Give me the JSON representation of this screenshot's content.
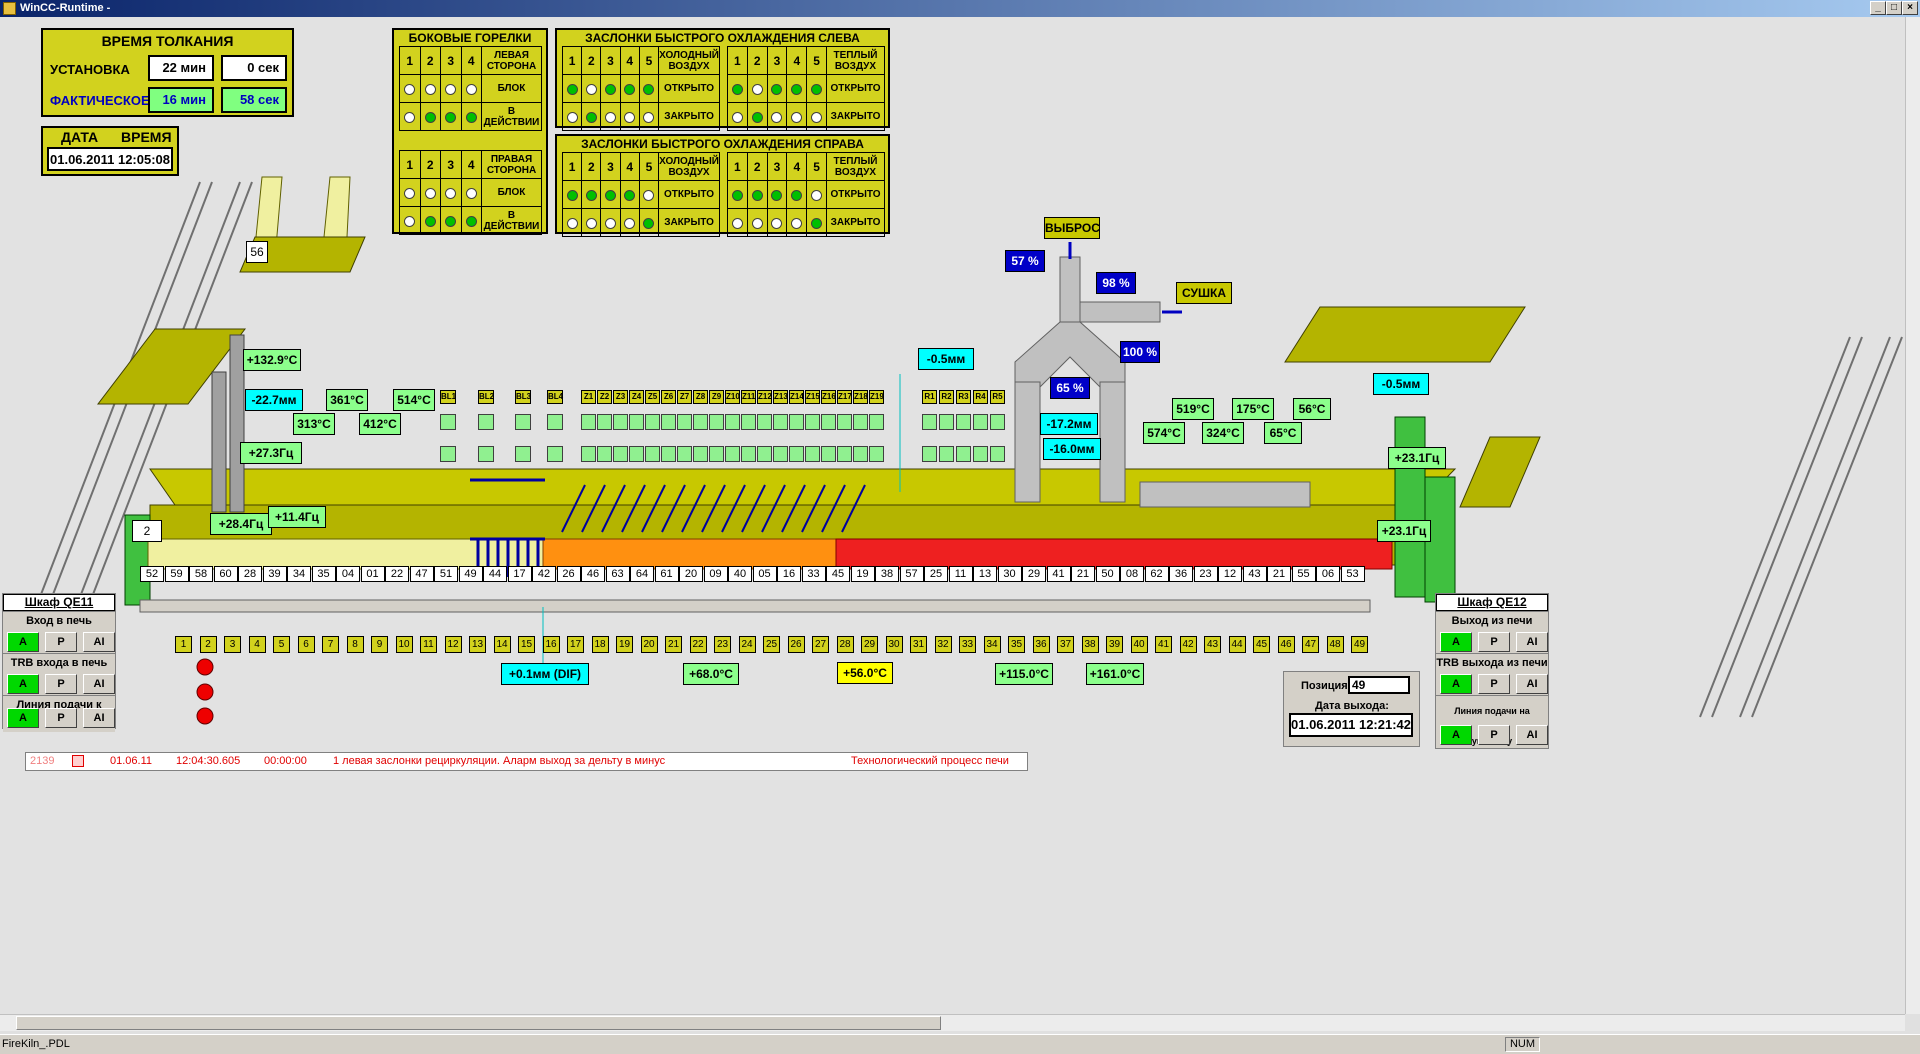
{
  "window": {
    "title": "WinCC-Runtime -"
  },
  "push_time": {
    "title": "ВРЕМЯ ТОЛКАНИЯ",
    "setting_label": "УСТАНОВКА",
    "actual_label": "ФАКТИЧЕСКОЕ",
    "set_min": "22 мин",
    "set_sec": "0 сек",
    "act_min": "16 мин",
    "act_sec": "58 сек"
  },
  "datetime": {
    "date_label": "ДАТА",
    "time_label": "ВРЕМЯ",
    "value": "01.06.2011 12:05:08"
  },
  "burners": {
    "title": "БОКОВЫЕ ГОРЕЛКИ",
    "cols": [
      "1",
      "2",
      "3",
      "4"
    ],
    "left_side": "ЛЕВАЯ СТОРОНА",
    "right_side": "ПРАВАЯ СТОРОНА",
    "block": "БЛОК",
    "active": "В ДЕЙСТВИИ"
  },
  "cooling_left": {
    "title": "ЗАСЛОНКИ БЫСТРОГО ОХЛАЖДЕНИЯ СЛЕВА"
  },
  "cooling_right": {
    "title": "ЗАСЛОНКИ БЫСТРОГО ОХЛАЖДЕНИЯ СПРАВА"
  },
  "cooling_labels": {
    "cols": [
      "1",
      "2",
      "3",
      "4",
      "5"
    ],
    "cold": "ХОЛОДНЫЙ ВОЗДУХ",
    "warm": "ТЕПЛЫЙ ВОЗДУХ",
    "open": "ОТКРЫТО",
    "closed": "ЗАКРЫТО"
  },
  "labels": {
    "exhaust": "ВЫБРОС",
    "drying": "СУШКА",
    "cart_no": "56",
    "entry_no": "2"
  },
  "zone_labels": [
    "BL1",
    "BL2",
    "BL3",
    "BL4",
    "Z1",
    "Z2",
    "Z3",
    "Z4",
    "Z5",
    "Z6",
    "Z7",
    "Z8",
    "Z9",
    "Z10",
    "Z11",
    "Z12",
    "Z13",
    "Z14",
    "Z15",
    "Z16",
    "Z17",
    "Z18",
    "Z19",
    "R1",
    "R2",
    "R3",
    "R4",
    "R5"
  ],
  "readings": {
    "t1": "+132.9°C",
    "p1": "-22.7мм",
    "t_361": "361°C",
    "t_313": "313°C",
    "t_514": "514°C",
    "t_412": "412°C",
    "f1": "+27.3Гц",
    "f2": "+28.4Гц",
    "f3": "+11.4Гц",
    "p2": "-0.5мм",
    "d57": "57 %",
    "d98": "98 %",
    "d100": "100 %",
    "d65": "65 %",
    "p3": "-17.2мм",
    "p4": "-16.0мм",
    "t_519": "519°C",
    "t_175": "175°C",
    "t_56": "56°C",
    "t_574": "574°C",
    "t_324": "324°C",
    "t_65": "65°C",
    "p5": "-0.5мм",
    "f4": "+23.1Гц",
    "f5": "+23.1Гц",
    "dif": "+0.1мм (DIF)",
    "t_68": "+68.0°C",
    "t_56b": "+56.0°C",
    "t_115": "+115.0°C",
    "t_161": "+161.0°C"
  },
  "kiln_cars": [
    "52",
    "59",
    "58",
    "60",
    "28",
    "39",
    "34",
    "35",
    "04",
    "01",
    "22",
    "47",
    "51",
    "49",
    "44",
    "17",
    "42",
    "26",
    "46",
    "63",
    "64",
    "61",
    "20",
    "09",
    "40",
    "05",
    "16",
    "33",
    "45",
    "19",
    "38",
    "57",
    "25",
    "11",
    "13",
    "30",
    "29",
    "41",
    "21",
    "50",
    "08",
    "62",
    "36",
    "23",
    "12",
    "43",
    "21",
    "55",
    "06",
    "53"
  ],
  "positions": [
    "1",
    "2",
    "3",
    "4",
    "5",
    "6",
    "7",
    "8",
    "9",
    "10",
    "11",
    "12",
    "13",
    "14",
    "15",
    "16",
    "17",
    "18",
    "19",
    "20",
    "21",
    "22",
    "23",
    "24",
    "25",
    "26",
    "27",
    "28",
    "29",
    "30",
    "31",
    "32",
    "33",
    "34",
    "35",
    "36",
    "37",
    "38",
    "39",
    "40",
    "41",
    "42",
    "43",
    "44",
    "45",
    "46",
    "47",
    "48",
    "49"
  ],
  "cabinet_left": {
    "title": "Шкаф QE11",
    "rows": [
      "Вход в печь",
      "TRB входа в печь",
      "Линия подачи к печи"
    ],
    "btns": [
      "A",
      "P",
      "AI"
    ]
  },
  "cabinet_right": {
    "title": "Шкаф QE12",
    "rows": [
      "Выход из печи",
      "TRB выхода из печи",
      "Линия подачи на упаковку"
    ],
    "btns": [
      "A",
      "P",
      "AI"
    ]
  },
  "position_box": {
    "label": "Позиция N:",
    "value": "49",
    "exit_label": "Дата выхода:",
    "exit_value": "01.06.2011 12:21:42"
  },
  "alarm": {
    "id": "2139",
    "date": "01.06.11",
    "time": "12:04:30.605",
    "dur": "00:00:00",
    "text": "1 левая заслонки рециркуляции.  Аларм выход за дельту в минус",
    "area": "Технологический процесс печи"
  },
  "statusbar": {
    "file": "FireKiln_.PDL",
    "num": "NUM"
  }
}
